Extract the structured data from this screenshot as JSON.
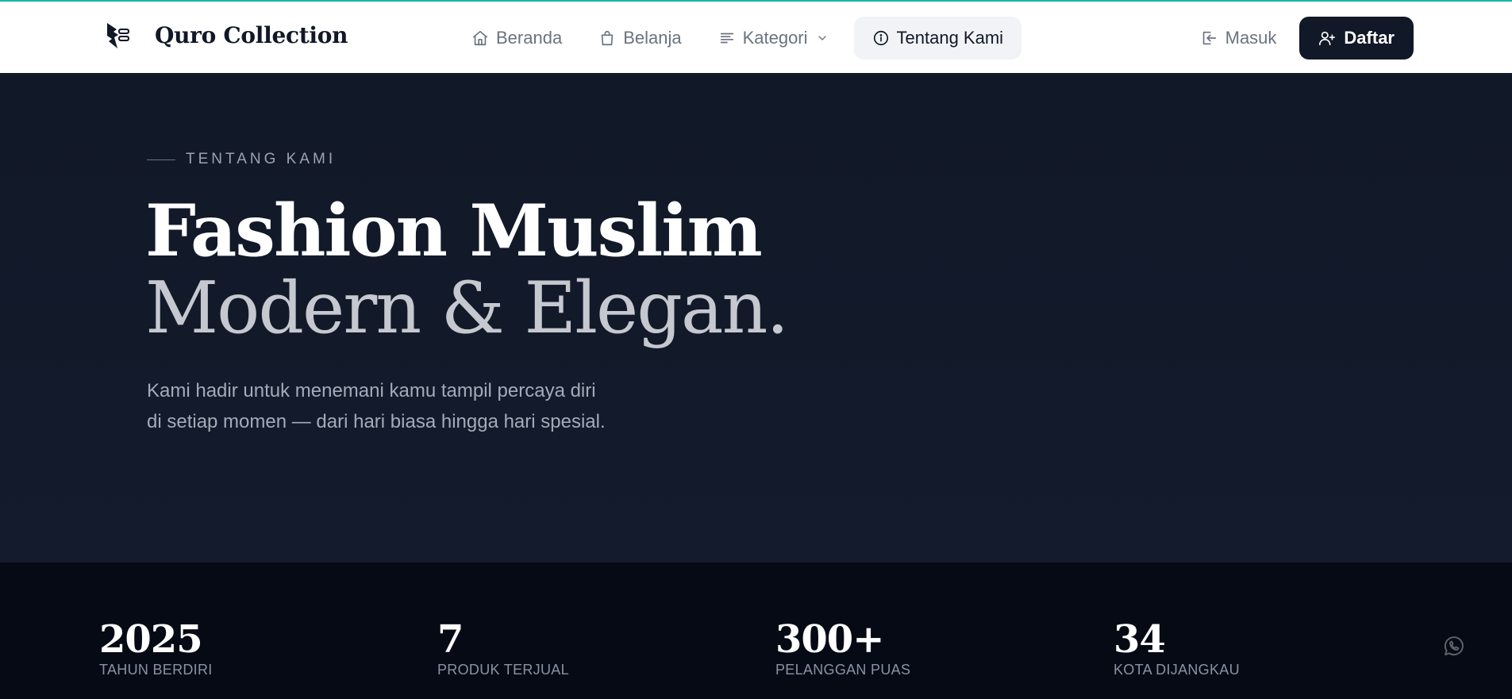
{
  "header": {
    "brand_name": "Quro Collection",
    "logo_icon": "qc-logo-icon",
    "nav": [
      {
        "label": "Beranda",
        "icon": "home-icon"
      },
      {
        "label": "Belanja",
        "icon": "shopping-bag-icon"
      },
      {
        "label": "Kategori",
        "icon": "menu-lines-icon",
        "dropdown": true
      },
      {
        "label": "Tentang Kami",
        "icon": "info-icon",
        "active": true
      }
    ],
    "login_label": "Masuk",
    "register_label": "Daftar"
  },
  "hero": {
    "eyebrow": "TENTANG KAMI",
    "headline_line1": "Fashion Muslim",
    "headline_line2": "Modern & Elegan.",
    "subtext": "Kami hadir untuk menemani kamu tampil percaya diri di setiap momen — dari hari biasa hingga hari spesial."
  },
  "stats": [
    {
      "value": "2025",
      "label": "TAHUN BERDIRI"
    },
    {
      "value": "7",
      "label": "PRODUK TERJUAL"
    },
    {
      "value": "300+",
      "label": "PELANGGAN PUAS"
    },
    {
      "value": "34",
      "label": "KOTA DIJANGKAU"
    }
  ],
  "floating": {
    "icon": "whatsapp-icon"
  },
  "colors": {
    "header_bg": "#ffffff",
    "hero_bg": "#111827",
    "stats_bg": "#050a15",
    "primary_button": "#111827",
    "top_accent": "#14b8a6"
  }
}
